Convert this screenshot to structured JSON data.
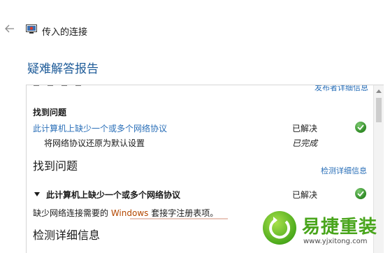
{
  "header": {
    "window_title": "传入的连接",
    "page_title": "疑难解答报告"
  },
  "report": {
    "cut_link": "发布者详细信息",
    "section1": {
      "heading": "找到问题",
      "issue_link": "此计算机上缺少一个或多个网络协议",
      "issue_status": "已解决",
      "fix_text": "将网络协议还原为默认设置",
      "fix_status": "已完成"
    },
    "section2": {
      "heading": "找到问题",
      "details_link": "检测详细信息",
      "issue_title": "此计算机上缺少一个或多个网络协议",
      "issue_status": "已解决",
      "desc_before": "缺少网络连接需要的 ",
      "desc_highlight": "Windows",
      "desc_after": " 套接字注册表项。"
    },
    "section3": {
      "heading": "检测详细信息"
    }
  },
  "watermark": {
    "brand": "易捷重装",
    "url": "www.yjxitong.com"
  },
  "colors": {
    "link": "#2a6fb8",
    "title": "#1f5c99",
    "check": "#2f8a25",
    "brand": "#49a51c"
  }
}
